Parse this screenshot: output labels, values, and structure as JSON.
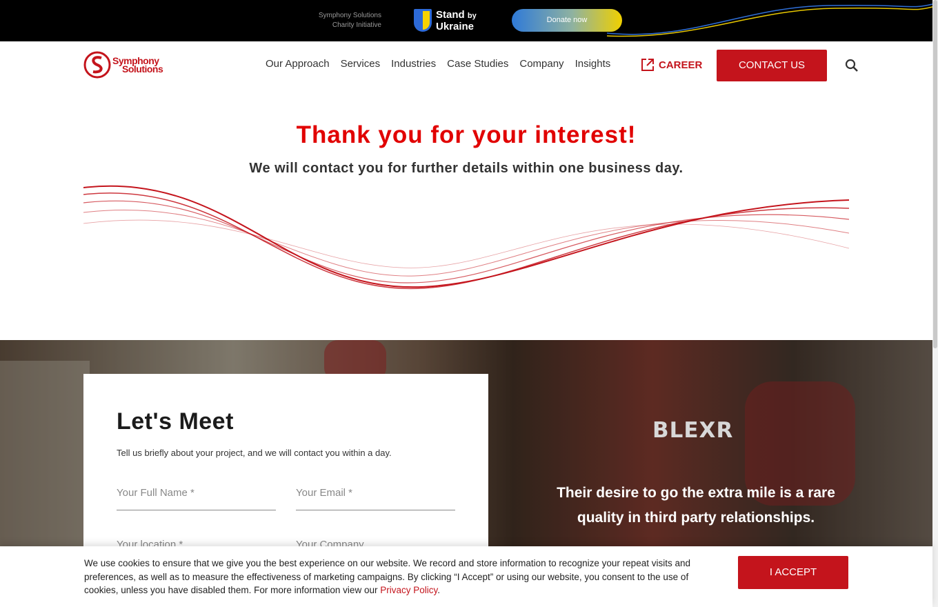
{
  "topbar": {
    "charity_line1": "Symphony Solutions",
    "charity_line2": "Charity Initiative",
    "ukraine_line1": "Stand",
    "ukraine_by": "by",
    "ukraine_line2": "Ukraine",
    "donate_label": "Donate now"
  },
  "header": {
    "logo_line1": "Symphony",
    "logo_line2": "Solutions",
    "nav": [
      "Our Approach",
      "Services",
      "Industries",
      "Case Studies",
      "Company",
      "Insights"
    ],
    "career_label": "CAREER",
    "contact_label": "CONTACT US"
  },
  "hero": {
    "title": "Thank you for your interest!",
    "subtitle": "We will contact you for further details within one business day."
  },
  "meet": {
    "title": "Let's Meet",
    "description": "Tell us briefly about your project, and we will contact you within a day.",
    "fields": {
      "full_name": "Your Full Name *",
      "email": "Your Email *",
      "location": "Your location *",
      "company": "Your Company"
    },
    "client_logo": "BLEXR",
    "quote": "Their desire to go the extra mile is a rare quality in third party relationships."
  },
  "cookie": {
    "text": "We use cookies to ensure that we give you the best experience on our website. We record and store information to recognize your repeat visits and preferences, as well as to measure the effectiveness of marketing campaigns. By clicking “I Accept” or using our website, you consent to the use of cookies, unless you have disabled them. For more information view our",
    "link": "Privacy Policy",
    "link_suffix": ".",
    "accept_label": "I ACCEPT"
  },
  "colors": {
    "brand_red": "#c4141c",
    "title_red": "#e10000",
    "topbar_bg": "#000000"
  }
}
